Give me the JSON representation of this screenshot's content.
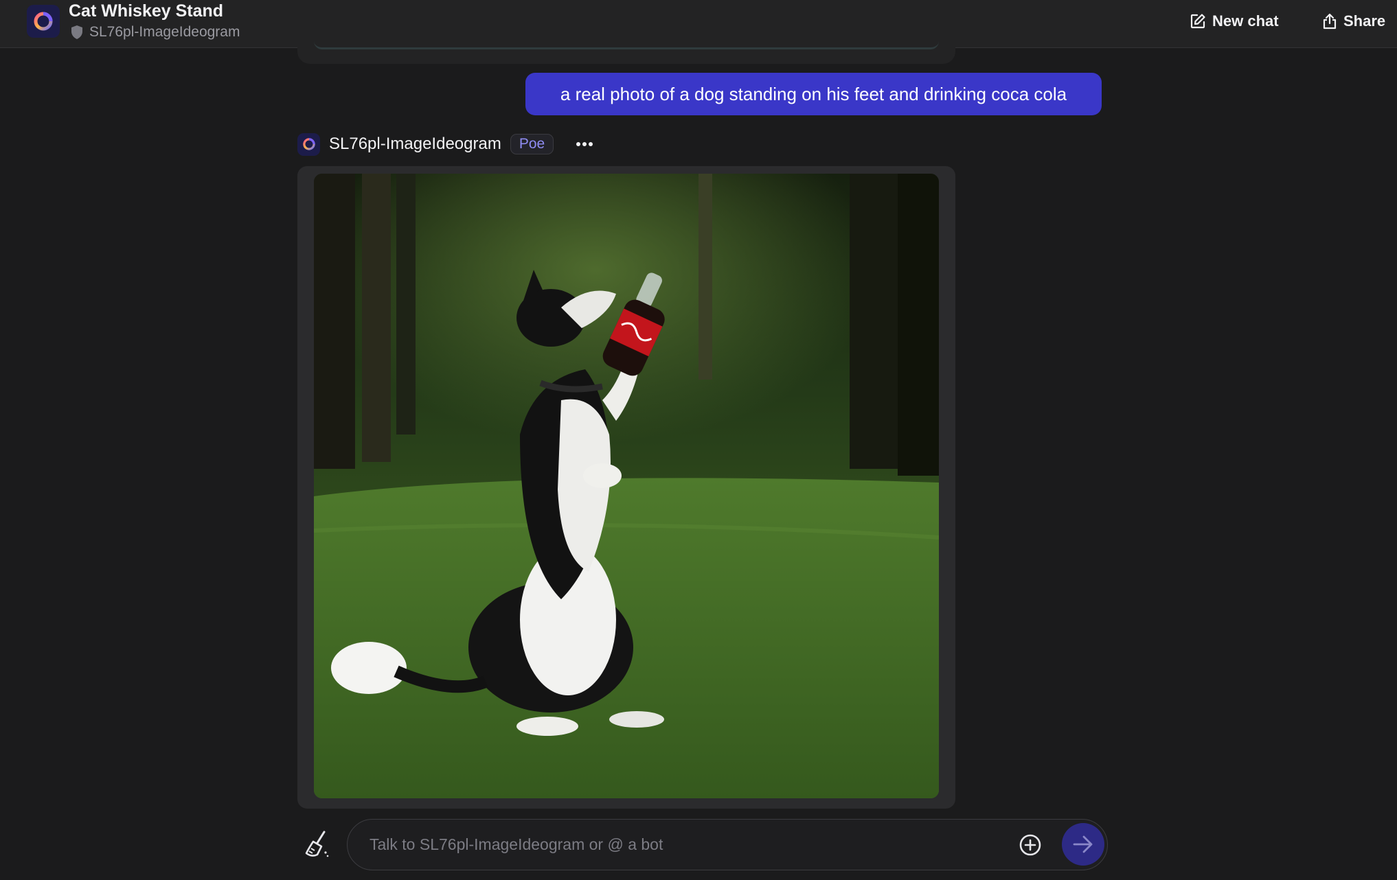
{
  "header": {
    "title": "Cat Whiskey Stand",
    "bot_name": "SL76pl-ImageIdeogram",
    "new_chat_label": "New chat",
    "share_label": "Share",
    "icons": {
      "avatar": "poe-swirl-logo-icon",
      "shield": "shield-icon",
      "new_chat": "edit-square-icon",
      "share": "share-upload-icon"
    }
  },
  "conversation": {
    "user_message": "a real photo of a dog standing on his feet and drinking coca cola",
    "bot_response": {
      "bot_name": "SL76pl-ImageIdeogram",
      "badge": "Poe",
      "more_icon": "ellipsis-icon",
      "image": {
        "alt": "Generated photo: black and white dog sitting up on grass in a forest clearing, holding a Coca-Cola bottle in its paw and drinking from it"
      }
    }
  },
  "composer": {
    "placeholder": "Talk to SL76pl-ImageIdeogram or @ a bot",
    "value": "",
    "icons": {
      "clear": "broom-icon",
      "attach": "plus-circle-icon",
      "send": "arrow-right-icon"
    }
  },
  "colors": {
    "background": "#1b1b1c",
    "header_bg": "#232324",
    "user_bubble": "#3a37c8",
    "badge_text": "#8f8cf2",
    "send_button": "#2d2a86"
  }
}
